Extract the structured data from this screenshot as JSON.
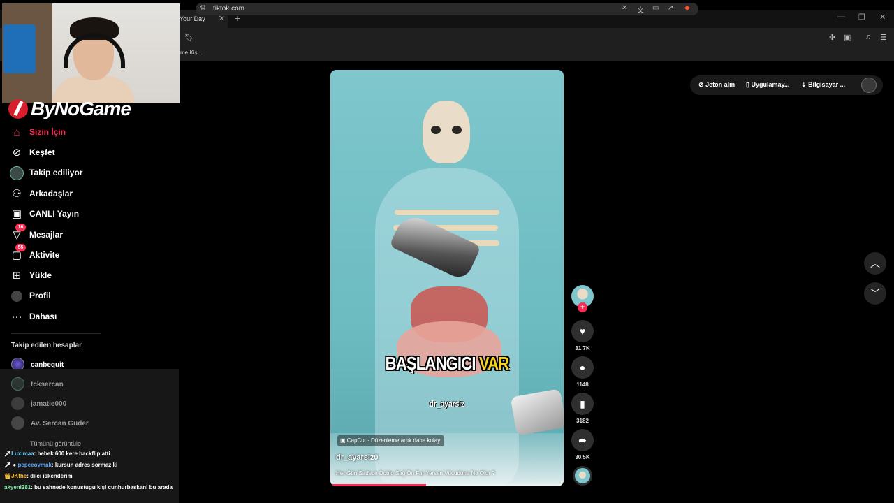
{
  "browser": {
    "tab_title": "Your Day",
    "tab_close": "✕",
    "new_tab": "+",
    "url": "tiktok.com",
    "bookmark_label": "me Kiş..."
  },
  "overlay": {
    "logo_text": "ByNoGame"
  },
  "sidebar": {
    "items": [
      {
        "label": "Sizin İçin",
        "icon": "home-icon",
        "active": true
      },
      {
        "label": "Keşfet",
        "icon": "compass-icon"
      },
      {
        "label": "Takip ediliyor",
        "icon": "following-avatar-icon"
      },
      {
        "label": "Arkadaşlar",
        "icon": "friends-icon"
      },
      {
        "label": "CANLI Yayın",
        "icon": "live-tv-icon"
      },
      {
        "label": "Mesajlar",
        "icon": "messages-icon",
        "badge": "16"
      },
      {
        "label": "Aktivite",
        "icon": "activity-icon",
        "badge": "55"
      },
      {
        "label": "Yükle",
        "icon": "upload-icon"
      },
      {
        "label": "Profil",
        "icon": "profile-icon"
      },
      {
        "label": "Dahası",
        "icon": "more-icon"
      }
    ],
    "following_title": "Takip edilen hesaplar",
    "following": [
      "canbequit",
      "tcksercan",
      "jamatie000",
      "Av. Sercan Güder"
    ],
    "see_all": "Tümünü görüntüle"
  },
  "chat": [
    {
      "user": "Luximaa",
      "msg": " bebek 600 kere backflip atti",
      "badge": "🗡"
    },
    {
      "user": "pepeeoymak",
      "msg": " kursun adres sormaz ki",
      "badge": "🗡 ●"
    },
    {
      "user": "JKthe",
      "msg": " dilci iskenderim",
      "badge": "👑"
    },
    {
      "user": "akyeni281",
      "msg": " bu sahnede konustugu kişi cunhurbaskani bu arada",
      "badge": ""
    }
  ],
  "video": {
    "caption_main": "BAŞLANGICI",
    "caption_accent": "VAR",
    "watermark": "dr_ayarsiz",
    "capcut": "CapCut · Düzenleme artık daha kolay",
    "author": "dr_ayarsiz0",
    "description": "Her Gün Sadece Doblo Sağ Ön Far Yersen Vücuduna Ne Olur ?",
    "progress": 0.41
  },
  "actions": {
    "likes": "31.7K",
    "comments": "1148",
    "saves": "3182",
    "shares": "30.5K"
  },
  "topbar": {
    "coins": "Jeton alın",
    "app": "Uygulamay...",
    "desktop": "Bilgisayar ..."
  },
  "colors": {
    "accent": "#fe2c55",
    "background": "#000000"
  }
}
